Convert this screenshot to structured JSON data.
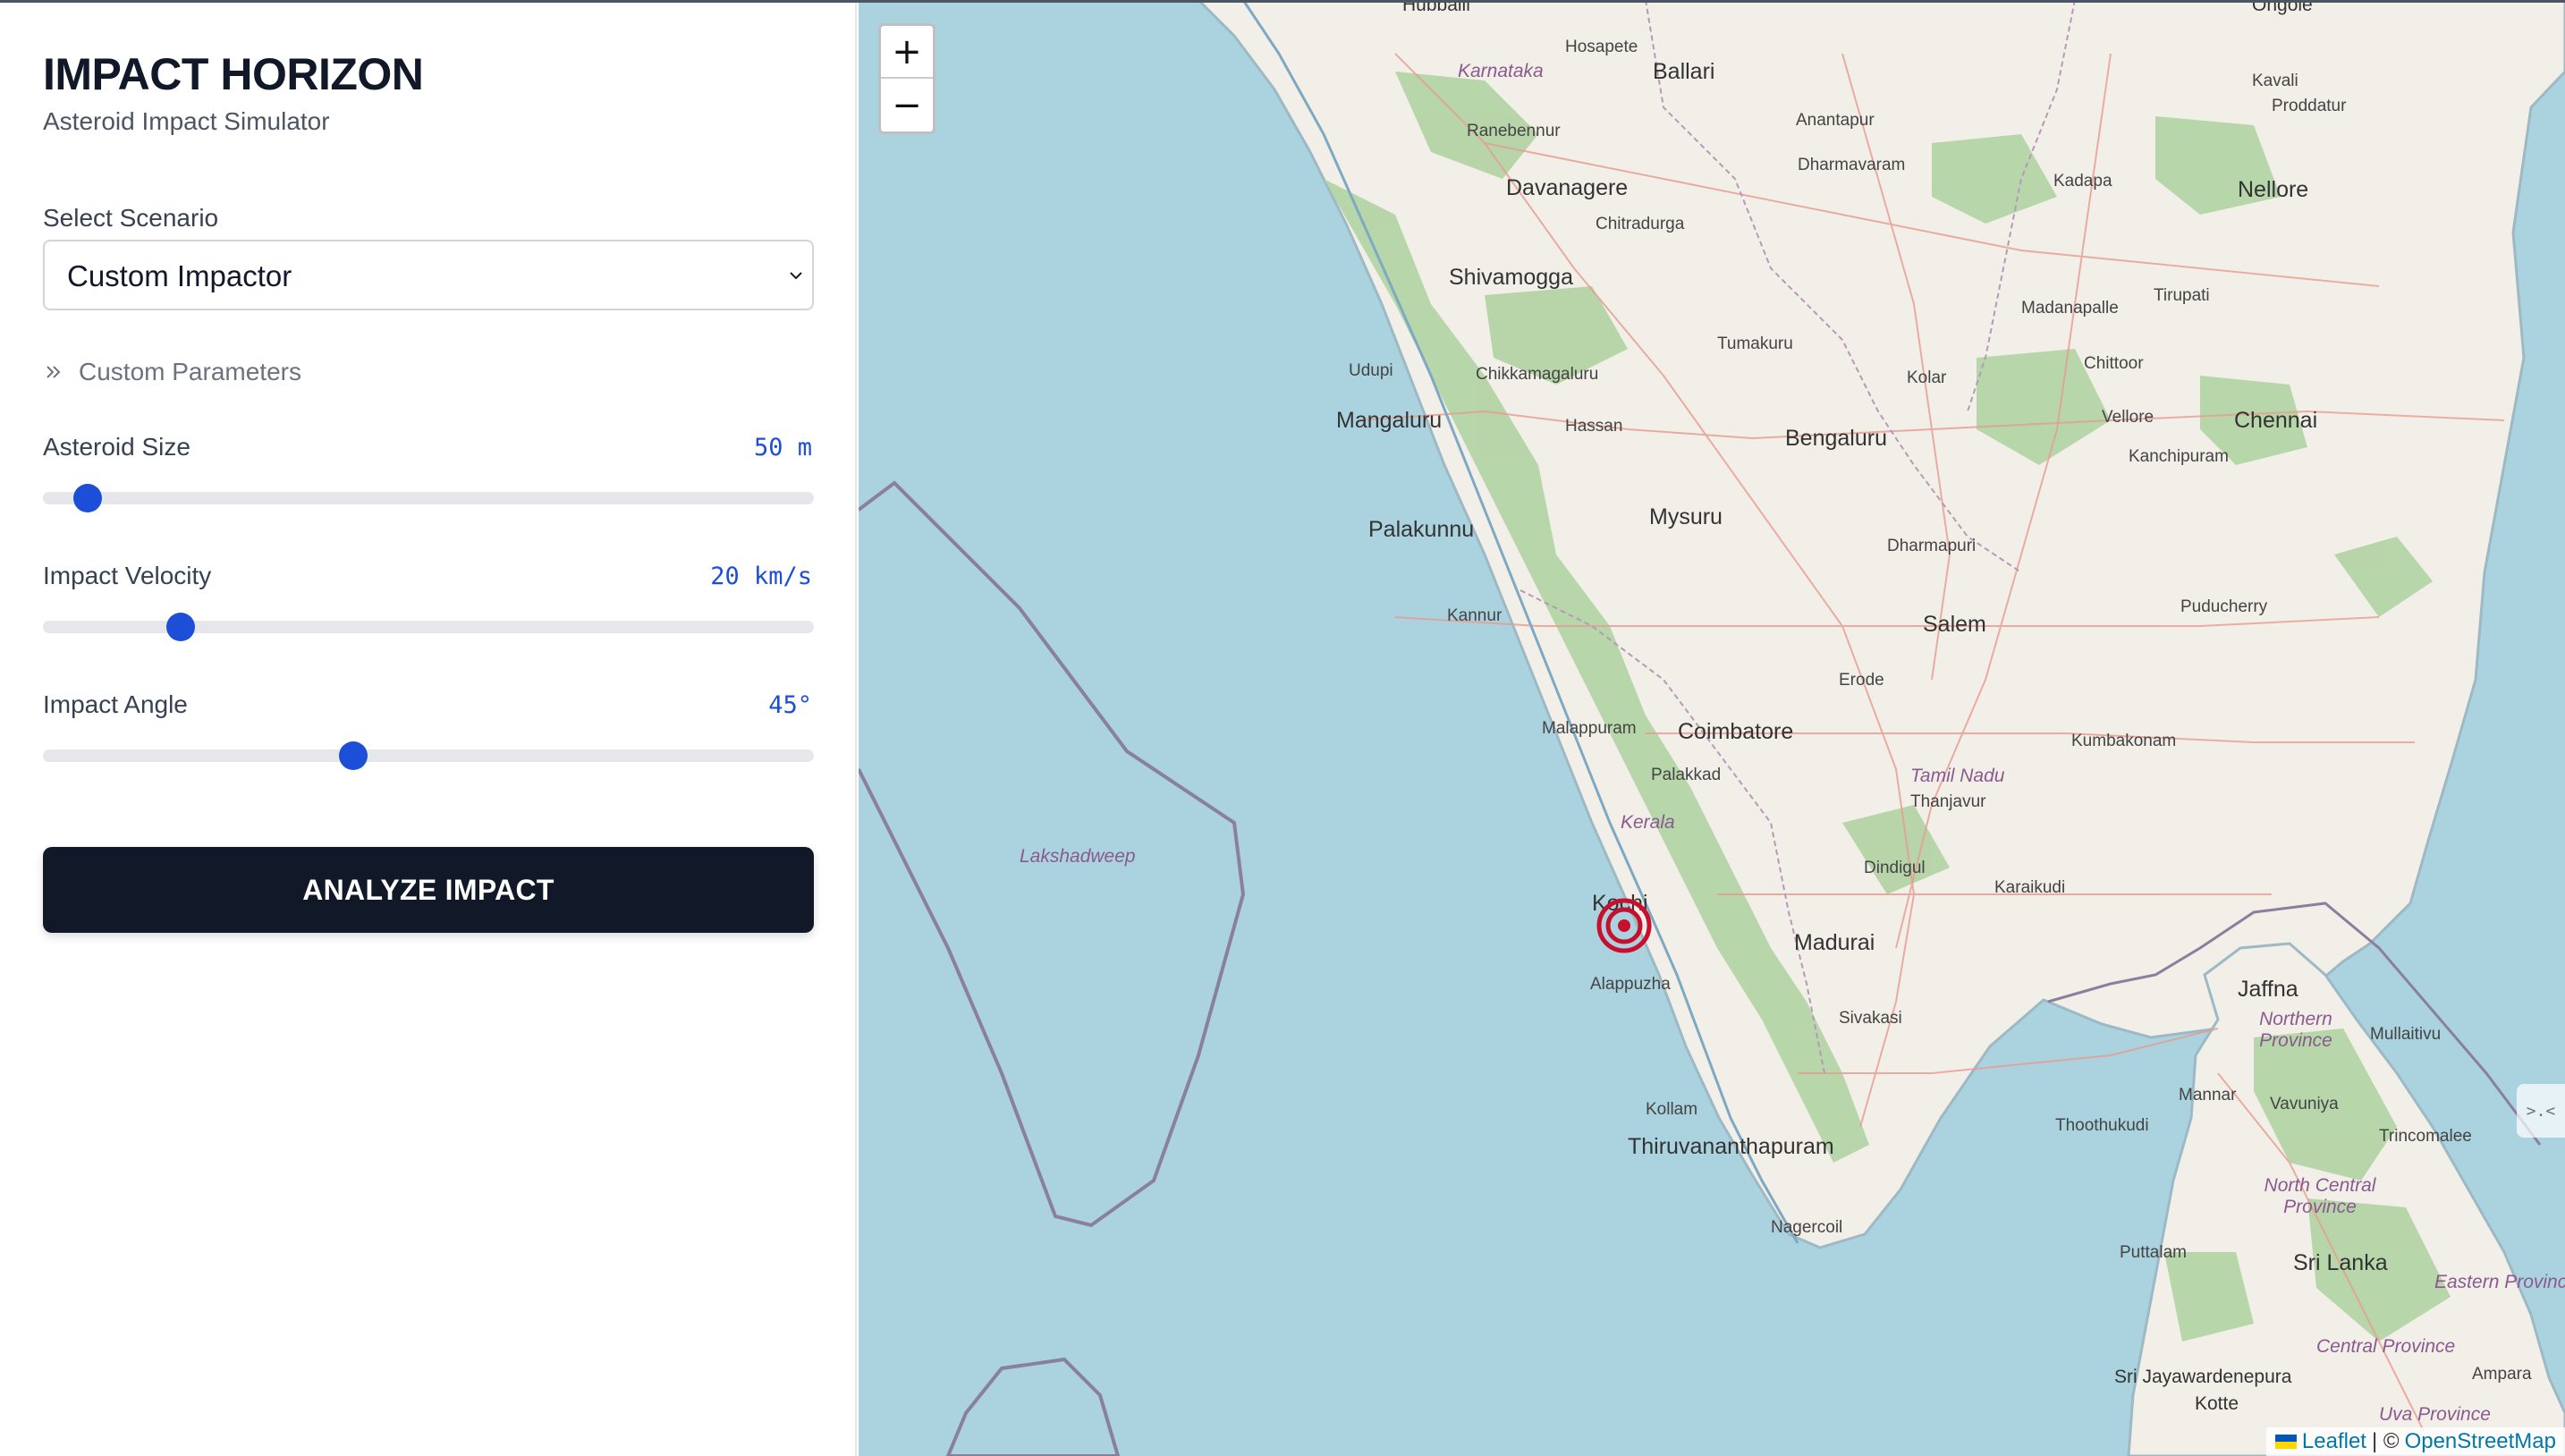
{
  "app": {
    "title": "IMPACT HORIZON",
    "subtitle": "Asteroid Impact Simulator"
  },
  "scenario": {
    "label": "Select Scenario",
    "selected": "Custom Impactor"
  },
  "custom_params": {
    "label": "Custom Parameters"
  },
  "params": {
    "size": {
      "label": "Asteroid Size",
      "value": "50 m",
      "fraction": 0.058
    },
    "velocity": {
      "label": "Impact Velocity",
      "value": "20 km/s",
      "fraction": 0.179
    },
    "angle": {
      "label": "Impact Angle",
      "value": "45°",
      "fraction": 0.403
    }
  },
  "actions": {
    "analyze": "ANALYZE IMPACT"
  },
  "map": {
    "zoom_in": "+",
    "zoom_out": "−",
    "attribution_leaflet": "Leaflet",
    "attribution_sep": "| ©",
    "attribution_osm": "OpenStreetMap",
    "side_tab": ">.<",
    "colors": {
      "water": "#aad3df",
      "land": "#f2efe9",
      "forest": "#add19e",
      "marker": "#c8102e"
    },
    "labels": {
      "hubballi": "Hubballi",
      "hosapete": "Hosapete",
      "ballari": "Ballari",
      "ongole": "Ongole",
      "karnataka": "Karnataka",
      "kavali": "Kavali",
      "proddatur": "Proddatur",
      "ranebennur": "Ranebennur",
      "anantapur": "Anantapur",
      "davanagere": "Davanagere",
      "dharmavaram": "Dharmavaram",
      "nellore": "Nellore",
      "kadapa": "Kadapa",
      "chitradurga": "Chitradurga",
      "shivamogga": "Shivamogga",
      "madanapalle": "Madanapalle",
      "tirupati": "Tirupati",
      "tumakuru": "Tumakuru",
      "udupi": "Udupi",
      "chikkamagaluru": "Chikkamagaluru",
      "chittoor": "Chittoor",
      "kolar": "Kolar",
      "mangaluru": "Mangaluru",
      "hassan": "Hassan",
      "bengaluru": "Bengaluru",
      "vellore": "Vellore",
      "chennai": "Chennai",
      "kanchipuram": "Kanchipuram",
      "palakunnu": "Palakunnu",
      "mysuru": "Mysuru",
      "dharmapuri": "Dharmapuri",
      "puducherry": "Puducherry",
      "kannur": "Kannur",
      "salem": "Salem",
      "erode": "Erode",
      "malappuram": "Malappuram",
      "coimbatore": "Coimbatore",
      "kumbakonam": "Kumbakonam",
      "palakkad": "Palakkad",
      "tamil_nadu": "Tamil Nadu",
      "thanjavur": "Thanjavur",
      "kerala": "Kerala",
      "lakshadweep": "Lakshadweep",
      "dindigul": "Dindigul",
      "karaikudi": "Karaikudi",
      "kochi": "Kochi",
      "madurai": "Madurai",
      "alappuzha": "Alappuzha",
      "jaffna": "Jaffna",
      "sivakasi": "Sivakasi",
      "northern_province": "Northern Province",
      "mullaitivu": "Mullaitivu",
      "mannar": "Mannar",
      "vavuniya": "Vavuniya",
      "kollam": "Kollam",
      "thoothukudi": "Thoothukudi",
      "trincomalee": "Trincomalee",
      "thiruvananthapuram": "Thiruvananthapuram",
      "north_central_province": "North Central Province",
      "nagercoil": "Nagercoil",
      "puttalam": "Puttalam",
      "sri_lanka": "Sri Lanka",
      "eastern_province": "Eastern Province",
      "central_province": "Central Province",
      "sri_jayawardenepura": "Sri Jayawardenepura",
      "kotte": "Kotte",
      "ampara": "Ampara",
      "uva_province": "Uva Province"
    }
  }
}
